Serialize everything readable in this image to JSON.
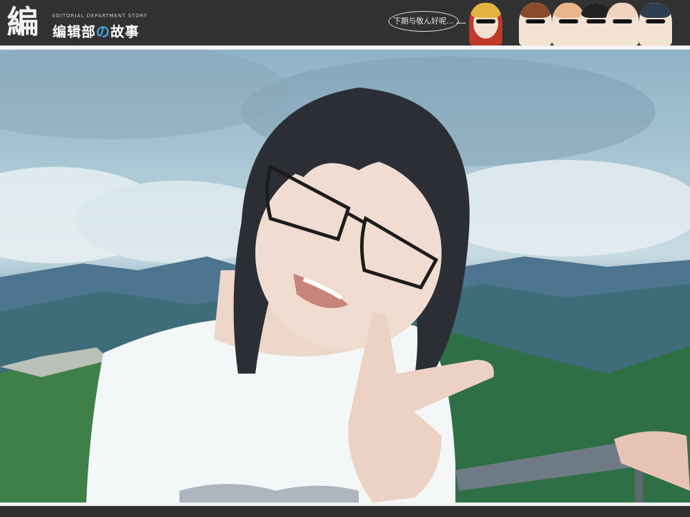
{
  "header": {
    "logo_mark": "編",
    "tagline": "EDITORIAL DEPARTMENT STORY",
    "title_part1": "编辑部",
    "title_accent": "の",
    "title_part2": "故事",
    "bubble_text": "下期与敬ん好呢…"
  },
  "avatars": [
    {
      "name": "avatar-1",
      "hair": "#e3b341",
      "accent": "#c0392b"
    },
    {
      "name": "avatar-2",
      "hair": "#8a4b2d",
      "accent": "#f3e2d2"
    },
    {
      "name": "avatar-3",
      "hair": "#e9b48a",
      "accent": "#f3e2d2"
    },
    {
      "name": "avatar-4",
      "hair": "#222222",
      "accent": "#f3e2d2"
    },
    {
      "name": "avatar-5",
      "hair": "#f0d2bd",
      "accent": "#f3e2d2"
    },
    {
      "name": "avatar-6",
      "hair": "#2c3e50",
      "accent": "#f3e2d2"
    }
  ],
  "colors": {
    "header_bg": "#2f2f2f",
    "accent_blue": "#4aa3df",
    "border": "#f4f4f4"
  }
}
